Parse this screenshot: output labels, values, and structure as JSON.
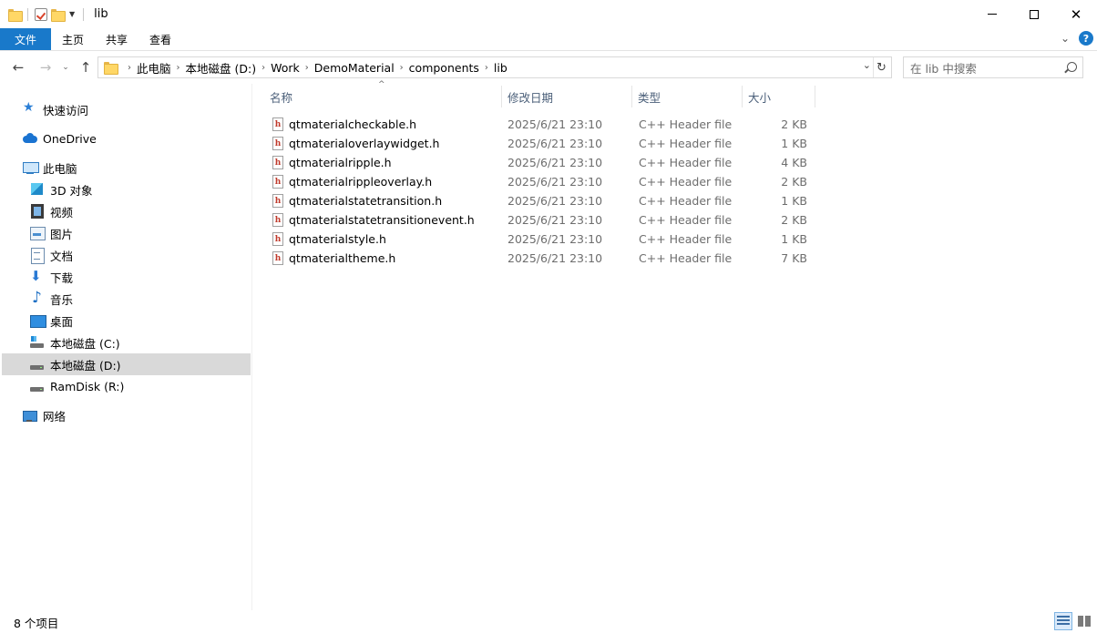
{
  "window": {
    "title": "lib"
  },
  "ribbon": {
    "tabs": [
      "文件",
      "主页",
      "共享",
      "查看"
    ],
    "help": "?"
  },
  "nav": {
    "breadcrumb": [
      "此电脑",
      "本地磁盘 (D:)",
      "Work",
      "DemoMaterial",
      "components",
      "lib"
    ],
    "search_placeholder": "在 lib 中搜索"
  },
  "sidebar": {
    "items": [
      {
        "label": "快速访问",
        "icon": "star-icon"
      },
      {
        "label": "OneDrive",
        "icon": "cloud-icon"
      },
      {
        "label": "此电脑",
        "icon": "computer-icon"
      },
      {
        "label": "3D 对象",
        "icon": "3d-objects-icon"
      },
      {
        "label": "视频",
        "icon": "video-icon"
      },
      {
        "label": "图片",
        "icon": "pictures-icon"
      },
      {
        "label": "文档",
        "icon": "documents-icon"
      },
      {
        "label": "下载",
        "icon": "download-icon"
      },
      {
        "label": "音乐",
        "icon": "music-icon"
      },
      {
        "label": "桌面",
        "icon": "desktop-icon"
      },
      {
        "label": "本地磁盘 (C:)",
        "icon": "drive-c-icon"
      },
      {
        "label": "本地磁盘 (D:)",
        "icon": "drive-icon",
        "selected": true
      },
      {
        "label": "RamDisk (R:)",
        "icon": "drive-icon"
      },
      {
        "label": "网络",
        "icon": "network-icon"
      }
    ]
  },
  "columns": {
    "name": "名称",
    "date": "修改日期",
    "type": "类型",
    "size": "大小"
  },
  "files": [
    {
      "name": "qtmaterialcheckable.h",
      "date": "2025/6/21 23:10",
      "type": "C++ Header file",
      "size": "2 KB"
    },
    {
      "name": "qtmaterialoverlaywidget.h",
      "date": "2025/6/21 23:10",
      "type": "C++ Header file",
      "size": "1 KB"
    },
    {
      "name": "qtmaterialripple.h",
      "date": "2025/6/21 23:10",
      "type": "C++ Header file",
      "size": "4 KB"
    },
    {
      "name": "qtmaterialrippleoverlay.h",
      "date": "2025/6/21 23:10",
      "type": "C++ Header file",
      "size": "2 KB"
    },
    {
      "name": "qtmaterialstatetransition.h",
      "date": "2025/6/21 23:10",
      "type": "C++ Header file",
      "size": "1 KB"
    },
    {
      "name": "qtmaterialstatetransitionevent.h",
      "date": "2025/6/21 23:10",
      "type": "C++ Header file",
      "size": "2 KB"
    },
    {
      "name": "qtmaterialstyle.h",
      "date": "2025/6/21 23:10",
      "type": "C++ Header file",
      "size": "1 KB"
    },
    {
      "name": "qtmaterialtheme.h",
      "date": "2025/6/21 23:10",
      "type": "C++ Header file",
      "size": "7 KB"
    }
  ],
  "file_icon_glyph": "h",
  "status": {
    "count": "8 个项目"
  },
  "colors": {
    "accent": "#1979ca",
    "selection": "#d9d9d9",
    "header_text": "#4c607a",
    "secondary_text": "#6d6d6d"
  }
}
